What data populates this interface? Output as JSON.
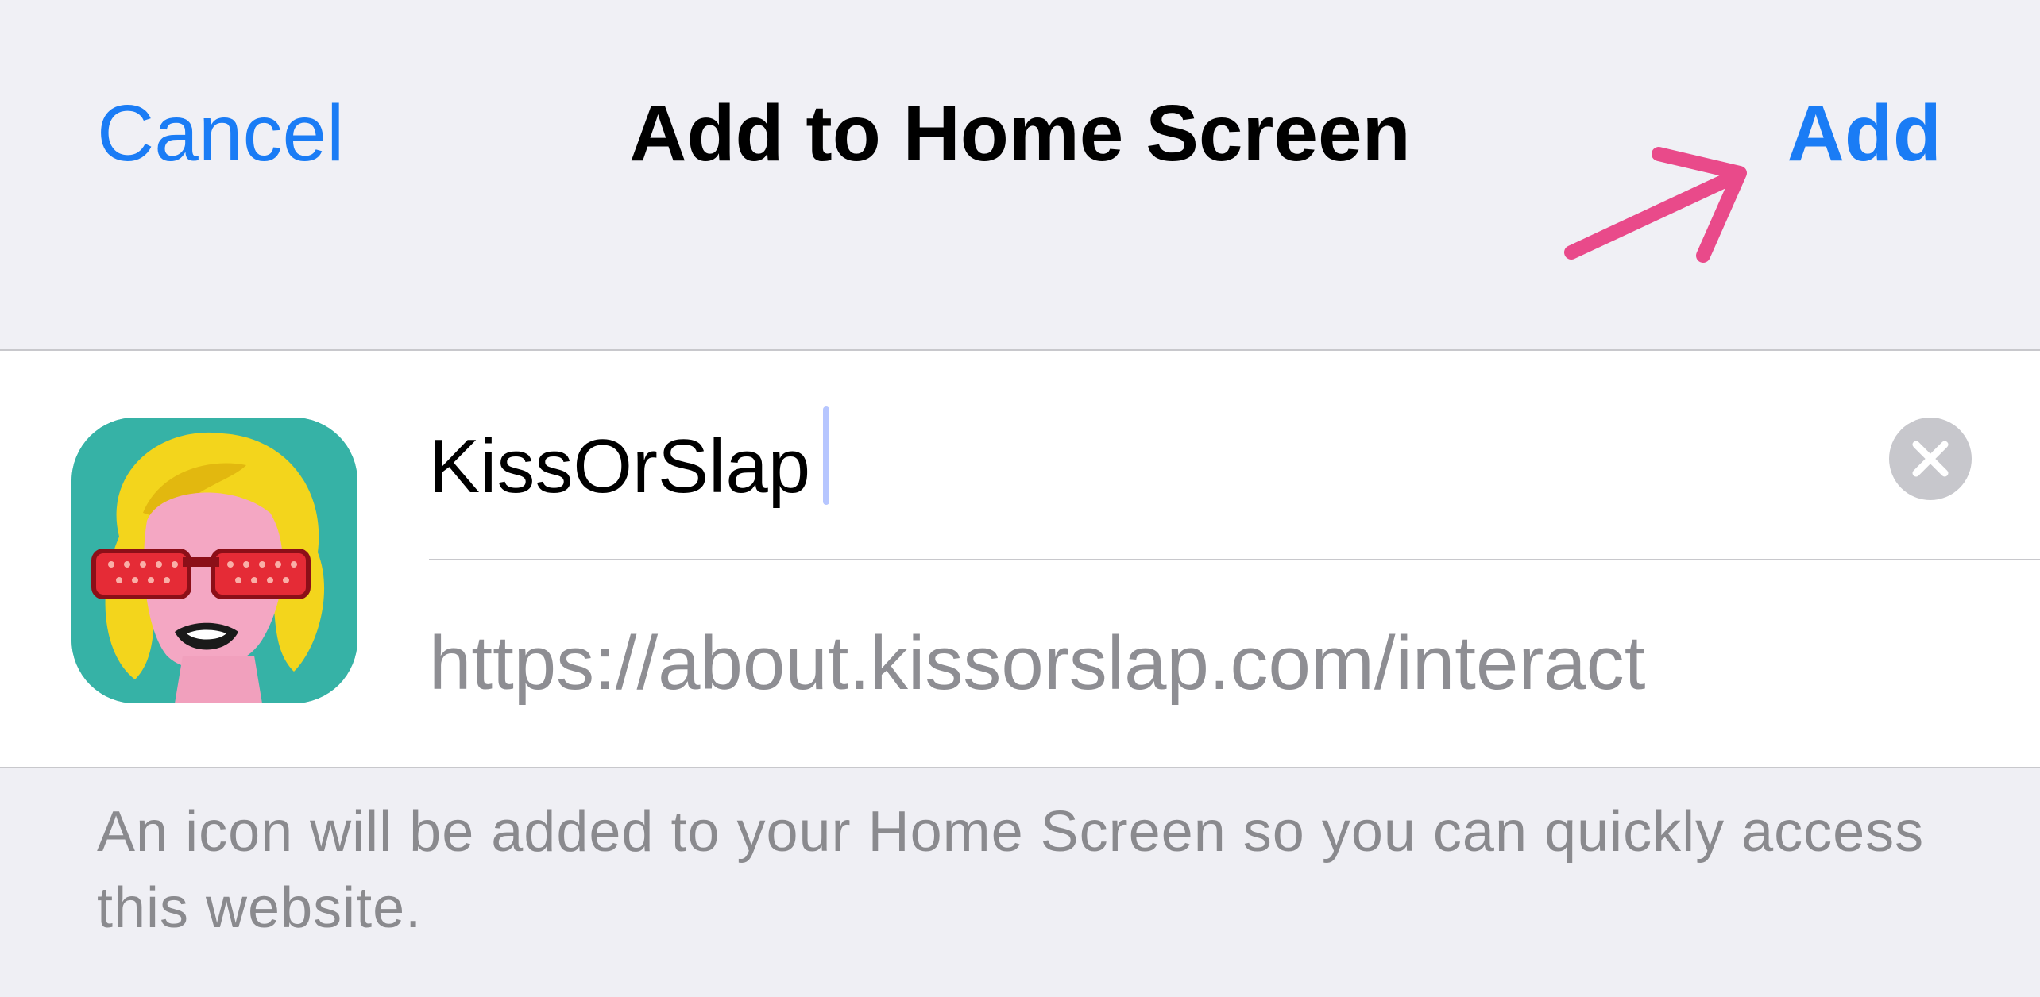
{
  "navbar": {
    "cancel_label": "Cancel",
    "title": "Add to Home Screen",
    "add_label": "Add"
  },
  "bookmark": {
    "icon": "kissorslap-app-icon",
    "name_value": "KissOrSlap",
    "url": "https://about.kissorslap.com/interact",
    "clear_icon": "clear-icon"
  },
  "footer": {
    "note": "An icon will be added to your Home Screen so you can quickly access this website."
  },
  "colors": {
    "accent": "#1a7cf5",
    "annotation_arrow": "#e94a8a",
    "secondary_text": "#8e8e93",
    "background": "#efeff4"
  }
}
